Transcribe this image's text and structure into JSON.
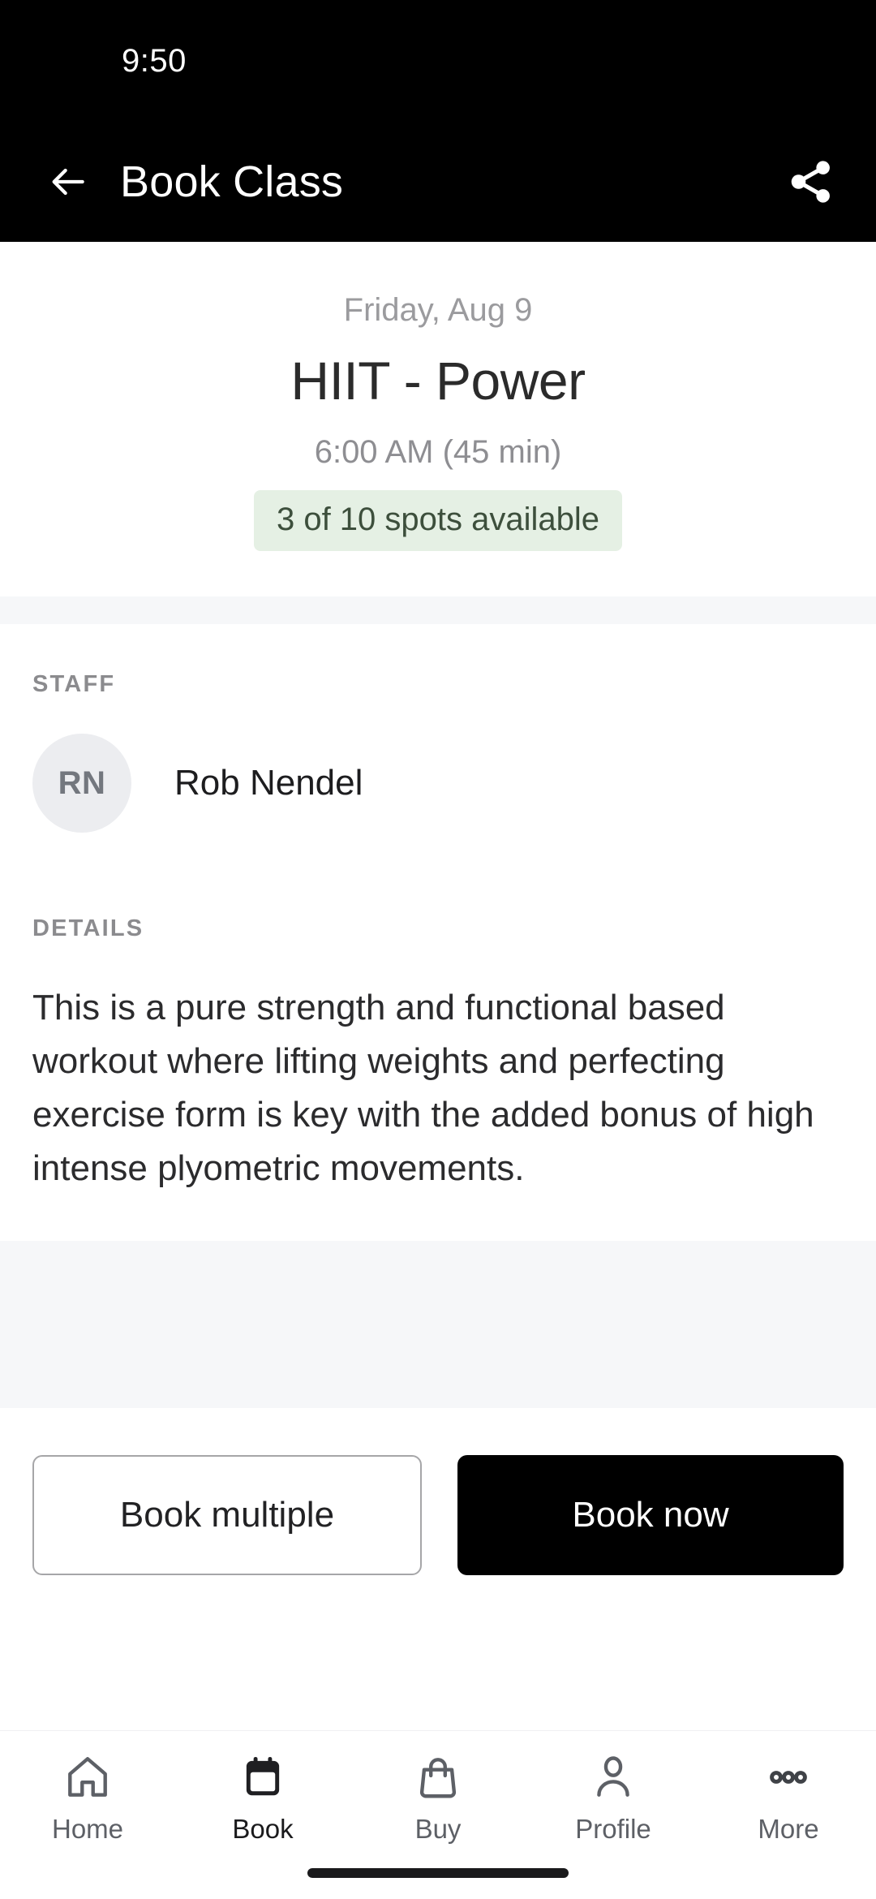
{
  "status_bar": {
    "time": "9:50"
  },
  "app_bar": {
    "title": "Book Class",
    "back_icon": "arrow-left-icon",
    "share_icon": "share-icon"
  },
  "class_info": {
    "date": "Friday, Aug 9",
    "title": "HIIT - Power",
    "time": "6:00 AM (45 min)",
    "availability": "3 of 10 spots available",
    "availability_bg": "#e5f0e4",
    "availability_color": "#3d4f3c"
  },
  "staff_section": {
    "label": "STAFF",
    "members": [
      {
        "initials": "RN",
        "name": "Rob Nendel"
      }
    ]
  },
  "details_section": {
    "label": "DETAILS",
    "body": "This is a pure strength and functional based workout where lifting weights and perfecting exercise form is key with the added bonus of high intense plyometric movements."
  },
  "actions": {
    "secondary_label": "Book multiple",
    "primary_label": "Book now"
  },
  "bottom_nav": {
    "items": [
      {
        "label": "Home",
        "icon": "home-icon",
        "active": false
      },
      {
        "label": "Book",
        "icon": "calendar-icon",
        "active": true
      },
      {
        "label": "Buy",
        "icon": "shopping-bag-icon",
        "active": false
      },
      {
        "label": "Profile",
        "icon": "person-icon",
        "active": false
      },
      {
        "label": "More",
        "icon": "more-dots-icon",
        "active": false
      }
    ]
  }
}
